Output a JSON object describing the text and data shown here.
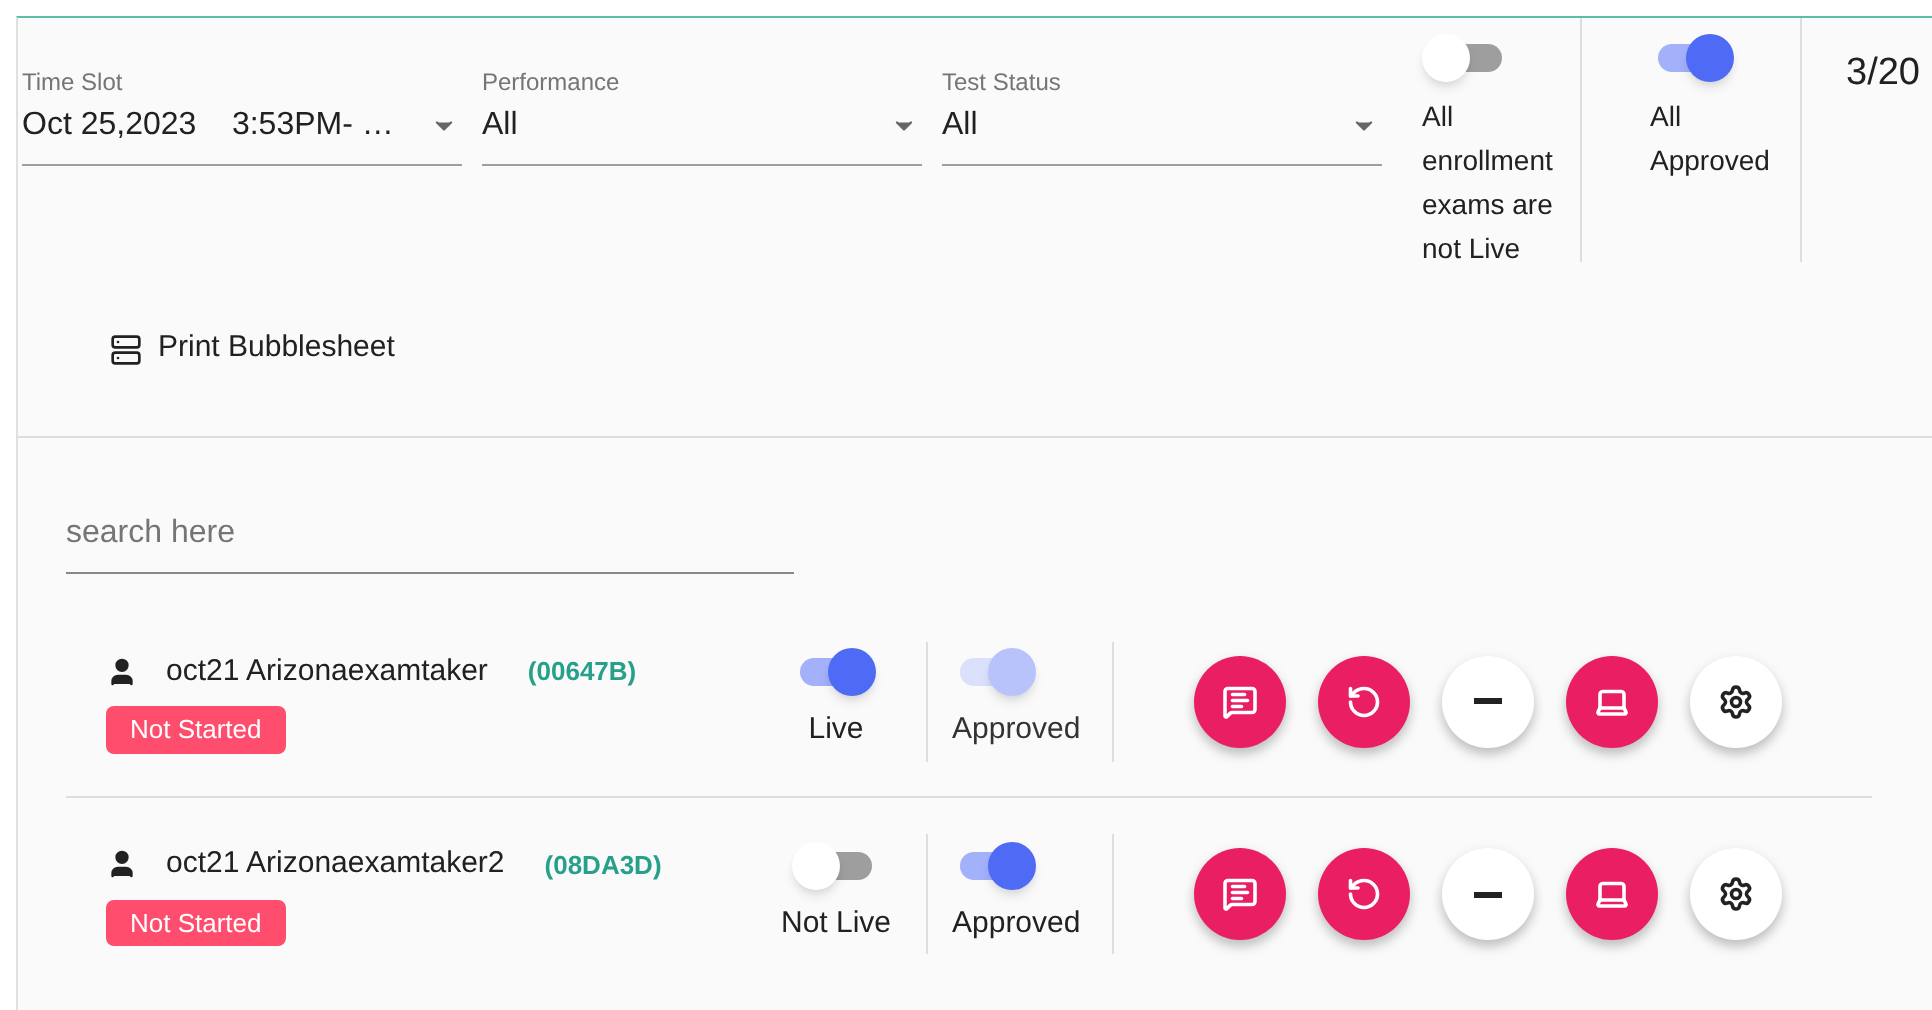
{
  "filters": [
    {
      "label": "Time Slot",
      "value": "Oct 25,2023    3:53PM- …"
    },
    {
      "label": "Performance",
      "value": "All"
    },
    {
      "label": "Test Status",
      "value": "All"
    }
  ],
  "global_toggles": [
    {
      "label": "All enrollment exams are not Live",
      "on": false
    },
    {
      "label": "All Approved",
      "on": true
    }
  ],
  "counter": "3/20",
  "print_button": "Print Bubblesheet",
  "search": {
    "placeholder": "search here"
  },
  "students": [
    {
      "name": "oct21 Arizonaexamtaker",
      "code": "(00647B)",
      "status": "Not Started",
      "live": {
        "label": "Live",
        "on": true,
        "disabled": false
      },
      "approved": {
        "label": "Approved",
        "on": true,
        "disabled": true
      }
    },
    {
      "name": "oct21 Arizonaexamtaker2",
      "code": "(08DA3D)",
      "status": "Not Started",
      "live": {
        "label": "Not Live",
        "on": false,
        "disabled": false
      },
      "approved": {
        "label": "Approved",
        "on": true,
        "disabled": false
      }
    }
  ]
}
